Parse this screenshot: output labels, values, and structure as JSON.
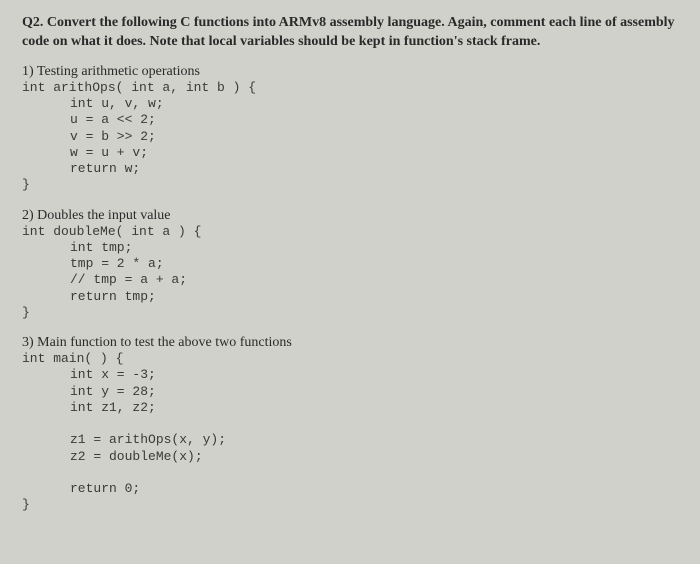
{
  "header": "Q2. Convert the following C functions into ARMv8 assembly language. Again, comment each line of assembly code on what it does. Note that local variables should be kept in function's stack frame.",
  "sections": [
    {
      "title": "1) Testing arithmetic operations",
      "sig": "int arithOps( int a, int b ) {",
      "body": "int u, v, w;\nu = a << 2;\nv = b >> 2;\nw = u + v;\nreturn w;",
      "close": "}"
    },
    {
      "title": "2) Doubles the input value",
      "sig": "int doubleMe( int a ) {",
      "body": "int tmp;\ntmp = 2 * a;\n// tmp = a + a;\nreturn tmp;",
      "close": "}"
    },
    {
      "title": "3) Main function to test the above two functions",
      "sig": "int main( ) {",
      "body": "int x = -3;\nint y = 28;\nint z1, z2;\n\nz1 = arithOps(x, y);\nz2 = doubleMe(x);\n\nreturn 0;",
      "close": "}"
    }
  ]
}
